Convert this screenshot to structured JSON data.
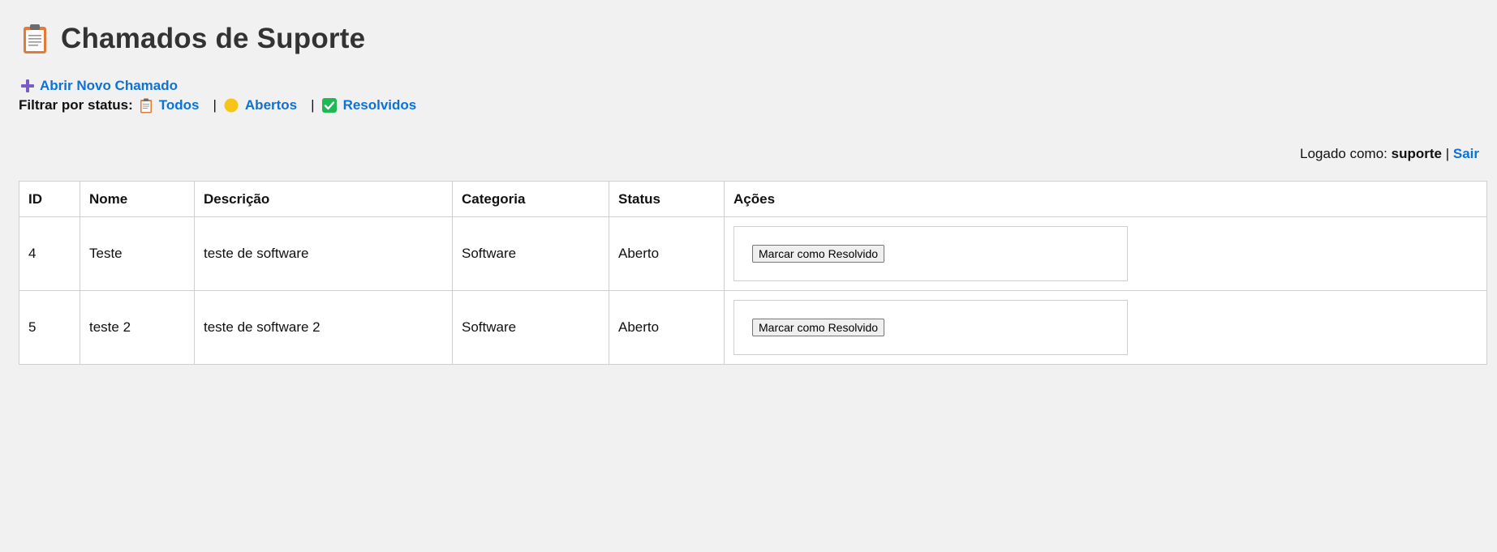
{
  "header": {
    "title": "Chamados de Suporte",
    "icon": "clipboard-icon"
  },
  "actions": {
    "new_ticket_label": "Abrir Novo Chamado",
    "new_ticket_icon": "plus-icon"
  },
  "filter": {
    "label": "Filtrar por status:",
    "separator": "|",
    "options": [
      {
        "label": "Todos",
        "icon": "clipboard-icon"
      },
      {
        "label": "Abertos",
        "icon": "yellow-circle-icon"
      },
      {
        "label": "Resolvidos",
        "icon": "check-box-icon"
      }
    ]
  },
  "session": {
    "prefix": "Logado como:",
    "username": "suporte",
    "separator": "|",
    "logout_label": "Sair"
  },
  "table": {
    "headers": [
      "ID",
      "Nome",
      "Descrição",
      "Categoria",
      "Status",
      "Ações"
    ],
    "rows": [
      {
        "id": "4",
        "nome": "Teste",
        "descricao": "teste de software",
        "categoria": "Software",
        "status": "Aberto",
        "action_label": "Marcar como Resolvido"
      },
      {
        "id": "5",
        "nome": "teste 2",
        "descricao": "teste de software 2",
        "categoria": "Software",
        "status": "Aberto",
        "action_label": "Marcar como Resolvido"
      }
    ]
  },
  "colors": {
    "link": "#0c72d6",
    "title": "#333333",
    "background": "#f1f1f1",
    "open_badge": "#f5c518",
    "resolved_badge": "#1db954"
  }
}
